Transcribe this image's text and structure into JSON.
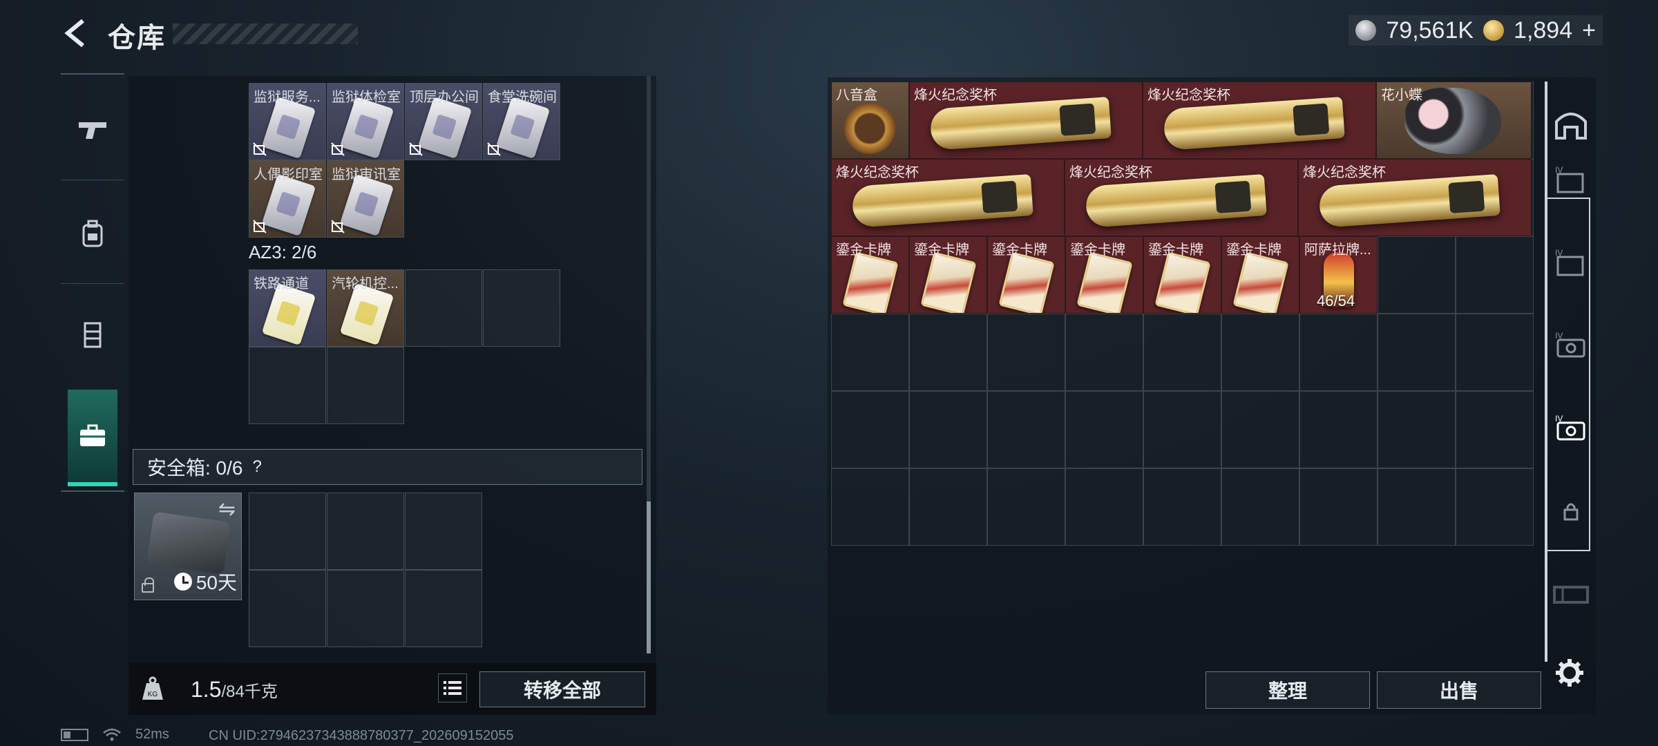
{
  "header": {
    "title": "仓库",
    "currency": [
      {
        "icon": "silver-coin-icon",
        "value": "79,561K"
      },
      {
        "icon": "gold-coin-icon",
        "value": "1,894",
        "suffix": "+"
      }
    ]
  },
  "tabs": [
    {
      "icon": "gun-icon",
      "active": false
    },
    {
      "icon": "backpack-icon",
      "active": false
    },
    {
      "icon": "vest-icon",
      "active": false
    },
    {
      "icon": "toolbox-icon",
      "active": true
    }
  ],
  "left": {
    "keys_row1": [
      "监狱服务...",
      "监狱体检室",
      "顶层办公间",
      "食堂洗碗间"
    ],
    "keys_row2": [
      "人偶影印室",
      "监狱审讯室"
    ],
    "az3_label": "AZ3: 2/6",
    "az3_items": [
      "铁路通道",
      "汽轮机控..."
    ],
    "safe_label": "安全箱: 0/6",
    "safe_help": "?",
    "safe_days": "50天",
    "weight_value": "1.5",
    "weight_max": "/84千克",
    "transfer_all": "转移全部"
  },
  "right": {
    "items": [
      {
        "label": "八音盒",
        "type": "bagua"
      },
      {
        "label": "烽火纪念奖杯",
        "type": "trophy"
      },
      {
        "label": "烽火纪念奖杯",
        "type": "trophy"
      },
      {
        "label": "花小蝶",
        "type": "toy"
      },
      {
        "label": "烽火纪念奖杯",
        "type": "trophy"
      },
      {
        "label": "烽火纪念奖杯",
        "type": "trophy"
      },
      {
        "label": "烽火纪念奖杯",
        "type": "trophy"
      },
      {
        "label": "鎏金卡牌",
        "type": "card"
      },
      {
        "label": "鎏金卡牌",
        "type": "card"
      },
      {
        "label": "鎏金卡牌",
        "type": "card"
      },
      {
        "label": "鎏金卡牌",
        "type": "card"
      },
      {
        "label": "鎏金卡牌",
        "type": "card"
      },
      {
        "label": "鎏金卡牌",
        "type": "card"
      },
      {
        "label": "阿萨拉牌...",
        "type": "capsule",
        "count": "46/54"
      }
    ],
    "sort_label": "整理",
    "sell_label": "出售"
  },
  "status": {
    "ping": "52ms",
    "uid": "CN UID:27946237343888780377_202609152055"
  },
  "colors": {
    "accent": "#2fd6b8",
    "item_red": "#5a2328",
    "item_purple": "#4a4d66"
  }
}
